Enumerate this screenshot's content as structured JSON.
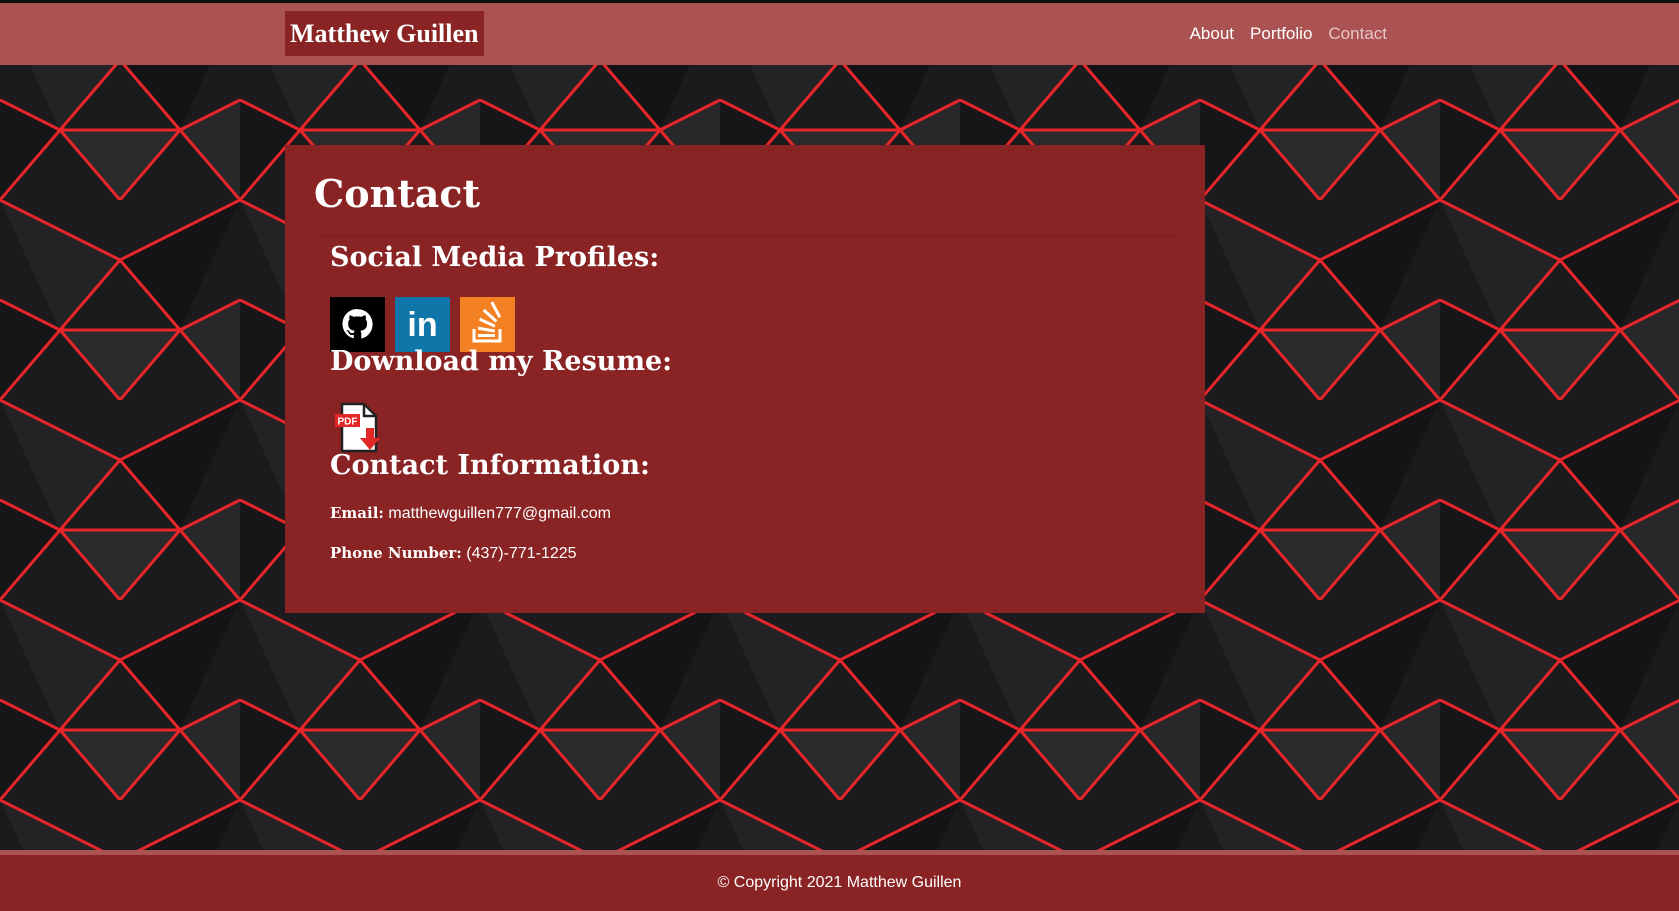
{
  "brand": {
    "name": "Matthew Guillen"
  },
  "nav": {
    "items": [
      {
        "label": "About"
      },
      {
        "label": "Portfolio"
      },
      {
        "label": "Contact"
      }
    ]
  },
  "contact": {
    "title": "Contact",
    "social_heading": "Social Media Profiles:",
    "social_icons": [
      "github-icon",
      "linkedin-icon",
      "stackoverflow-icon"
    ],
    "social_linkedin_text": "in",
    "resume_heading": "Download my Resume:",
    "resume_icon": "pdf-download-icon",
    "resume_icon_text": "PDF",
    "info_heading": "Contact Information:",
    "email_label": "Email:",
    "email_value": "matthewguillen777@gmail.com",
    "phone_label": "Phone Number:",
    "phone_value": "(437)-771-1225"
  },
  "footer": {
    "text": "© Copyright 2021 Matthew Guillen"
  },
  "colors": {
    "navbar": "#ab5252",
    "card": "#8a2323",
    "footer": "#8a2323",
    "background_dark": "#1b1b1d",
    "background_accent": "#e8252b",
    "github": "#000000",
    "linkedin": "#0e76a8",
    "stackoverflow": "#f48024"
  }
}
